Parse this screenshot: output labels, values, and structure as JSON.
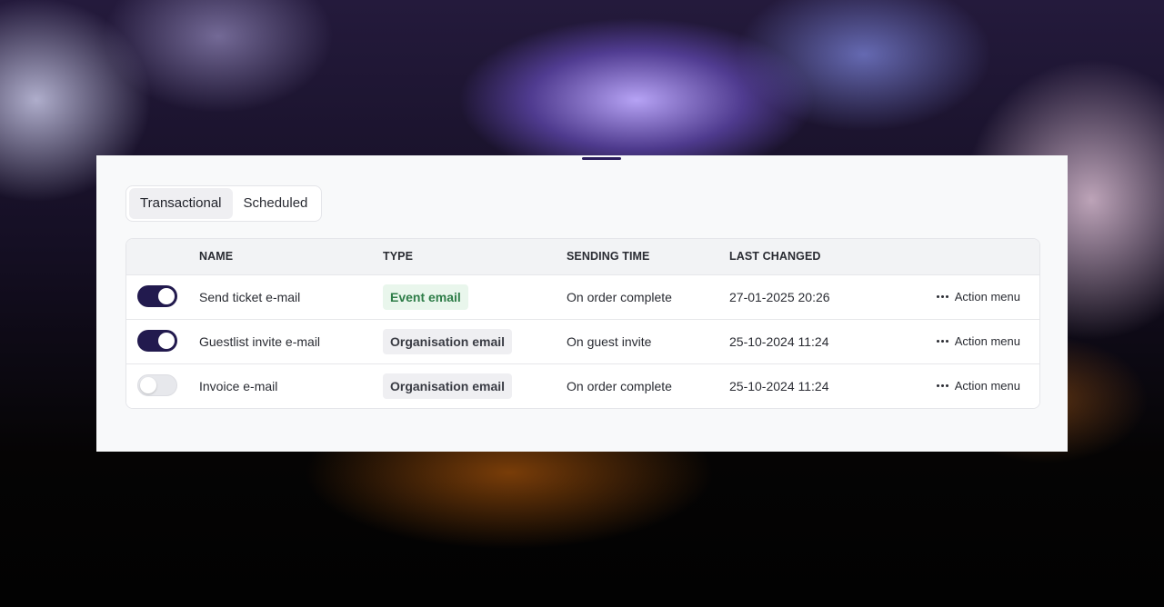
{
  "tabs": [
    {
      "label": "Transactional",
      "active": true
    },
    {
      "label": "Scheduled",
      "active": false
    }
  ],
  "table": {
    "headers": {
      "name": "NAME",
      "type": "TYPE",
      "sending_time": "SENDING TIME",
      "last_changed": "LAST CHANGED"
    },
    "rows": [
      {
        "enabled": true,
        "name": "Send ticket e-mail",
        "type": "Event email",
        "type_kind": "event",
        "sending_time": "On order complete",
        "last_changed": "27-01-2025 20:26",
        "action": "Action menu"
      },
      {
        "enabled": true,
        "name": "Guestlist invite e-mail",
        "type": "Organisation email",
        "type_kind": "org",
        "sending_time": "On guest invite",
        "last_changed": "25-10-2024 11:24",
        "action": "Action menu"
      },
      {
        "enabled": false,
        "name": "Invoice e-mail",
        "type": "Organisation email",
        "type_kind": "org",
        "sending_time": "On order complete",
        "last_changed": "25-10-2024 11:24",
        "action": "Action menu"
      }
    ]
  },
  "colors": {
    "toggle_on": "#221a4e",
    "event_badge_bg": "#e9f6ec",
    "event_badge_text": "#2e7d48",
    "org_badge_bg": "#efeff2"
  }
}
